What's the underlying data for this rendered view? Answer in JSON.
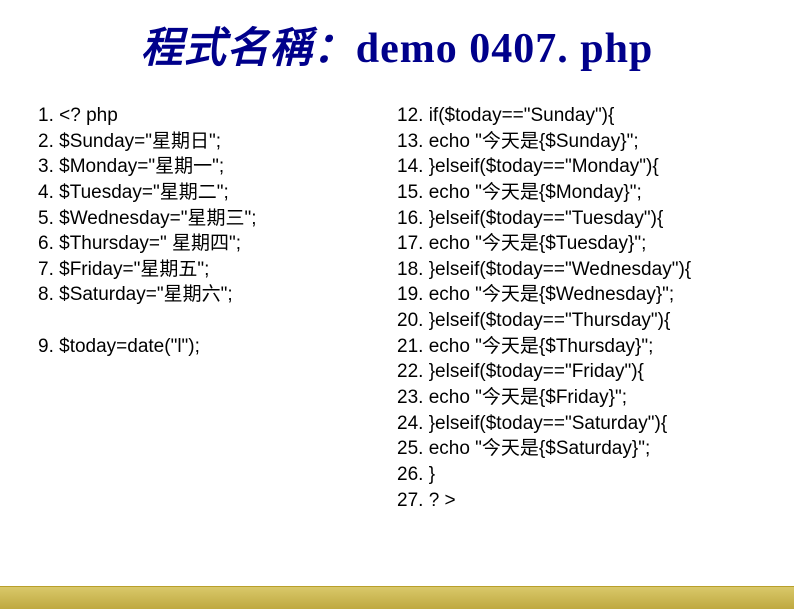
{
  "title": {
    "prefix": "程式名稱：",
    "main": "demo 0407. php"
  },
  "left": {
    "lines": [
      "1. <? php",
      "2. $Sunday=\"星期日\";",
      "3. $Monday=\"星期一\";",
      "4. $Tuesday=\"星期二\";",
      "5. $Wednesday=\"星期三\";",
      "6. $Thursday=\" 星期四\";",
      "7. $Friday=\"星期五\";",
      "8. $Saturday=\"星期六\";"
    ],
    "after_gap": [
      "9. $today=date(\"l\");"
    ]
  },
  "right": {
    "lines": [
      "12. if($today==\"Sunday\"){",
      "13. echo \"今天是{$Sunday}\";",
      "14. }elseif($today==\"Monday\"){",
      "15. echo \"今天是{$Monday}\";",
      "16. }elseif($today==\"Tuesday\"){",
      "17. echo \"今天是{$Tuesday}\";",
      "18. }elseif($today==\"Wednesday\"){",
      "19. echo \"今天是{$Wednesday}\";",
      "20. }elseif($today==\"Thursday\"){",
      "21. echo \"今天是{$Thursday}\";",
      "22. }elseif($today==\"Friday\"){",
      "23. echo \"今天是{$Friday}\";",
      "24. }elseif($today==\"Saturday\"){",
      "25. echo \"今天是{$Saturday}\";",
      "26. }",
      "27. ? >"
    ]
  }
}
